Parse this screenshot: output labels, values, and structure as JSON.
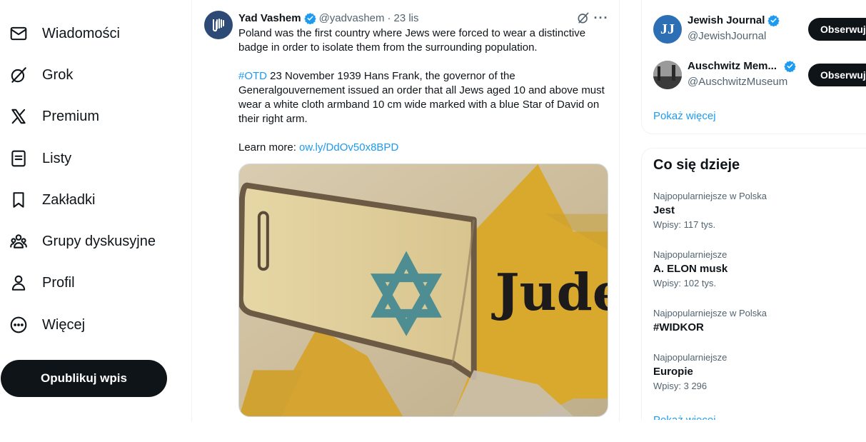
{
  "nav": {
    "items": [
      {
        "label": "Wiadomości",
        "icon": "mail-icon"
      },
      {
        "label": "Grok",
        "icon": "grok-icon"
      },
      {
        "label": "Premium",
        "icon": "x-logo-icon"
      },
      {
        "label": "Listy",
        "icon": "list-icon"
      },
      {
        "label": "Zakładki",
        "icon": "bookmark-icon"
      },
      {
        "label": "Grupy dyskusyjne",
        "icon": "communities-icon"
      },
      {
        "label": "Profil",
        "icon": "profile-icon"
      },
      {
        "label": "Więcej",
        "icon": "more-circle-icon"
      }
    ],
    "post_button": "Opublikuj wpis"
  },
  "tweet": {
    "author": "Yad Vashem",
    "handle": "@yadvashem",
    "separator": "·",
    "date": "23 lis",
    "more": "···",
    "paragraph1": "Poland was the first country where Jews were forced to wear a distinctive badge in order to isolate them from the surrounding population.",
    "hashtag": "#OTD",
    "paragraph2": " 23 November 1939 Hans Frank, the governor of the Generalgouvernement issued an order that all Jews aged 10 and above must wear a white cloth armband 10 cm wide marked with a blue Star of David on their right arm.",
    "learn_more": "Learn more: ",
    "link": "ow.ly/DdOv50x8BPD",
    "media_text": "Jude"
  },
  "who_to_follow": {
    "accounts": [
      {
        "name": "Jewish Journal",
        "handle": "@JewishJournal",
        "avatar_text": "JJ"
      },
      {
        "name": "Auschwitz Mem...",
        "handle": "@AuschwitzMuseum"
      }
    ],
    "follow_label": "Obserwuj",
    "show_more": "Pokaż więcej"
  },
  "trends": {
    "title": "Co się dzieje",
    "items": [
      {
        "context": "Najpopularniejsze w Polska",
        "name": "Jest",
        "count": "Wpisy: 117 tys."
      },
      {
        "context": "Najpopularniejsze",
        "name": "A. ELON musk",
        "count": "Wpisy: 102 tys."
      },
      {
        "context": "Najpopularniejsze w Polska",
        "name": "#WIDKOR",
        "count": ""
      },
      {
        "context": "Najpopularniejsze",
        "name": "Europie",
        "count": "Wpisy: 3 296"
      }
    ],
    "show_more": "Pokaż więcej"
  },
  "colors": {
    "accent": "#1d9bf0",
    "text": "#0f1419",
    "secondary": "#536471",
    "button": "#0f1419"
  }
}
